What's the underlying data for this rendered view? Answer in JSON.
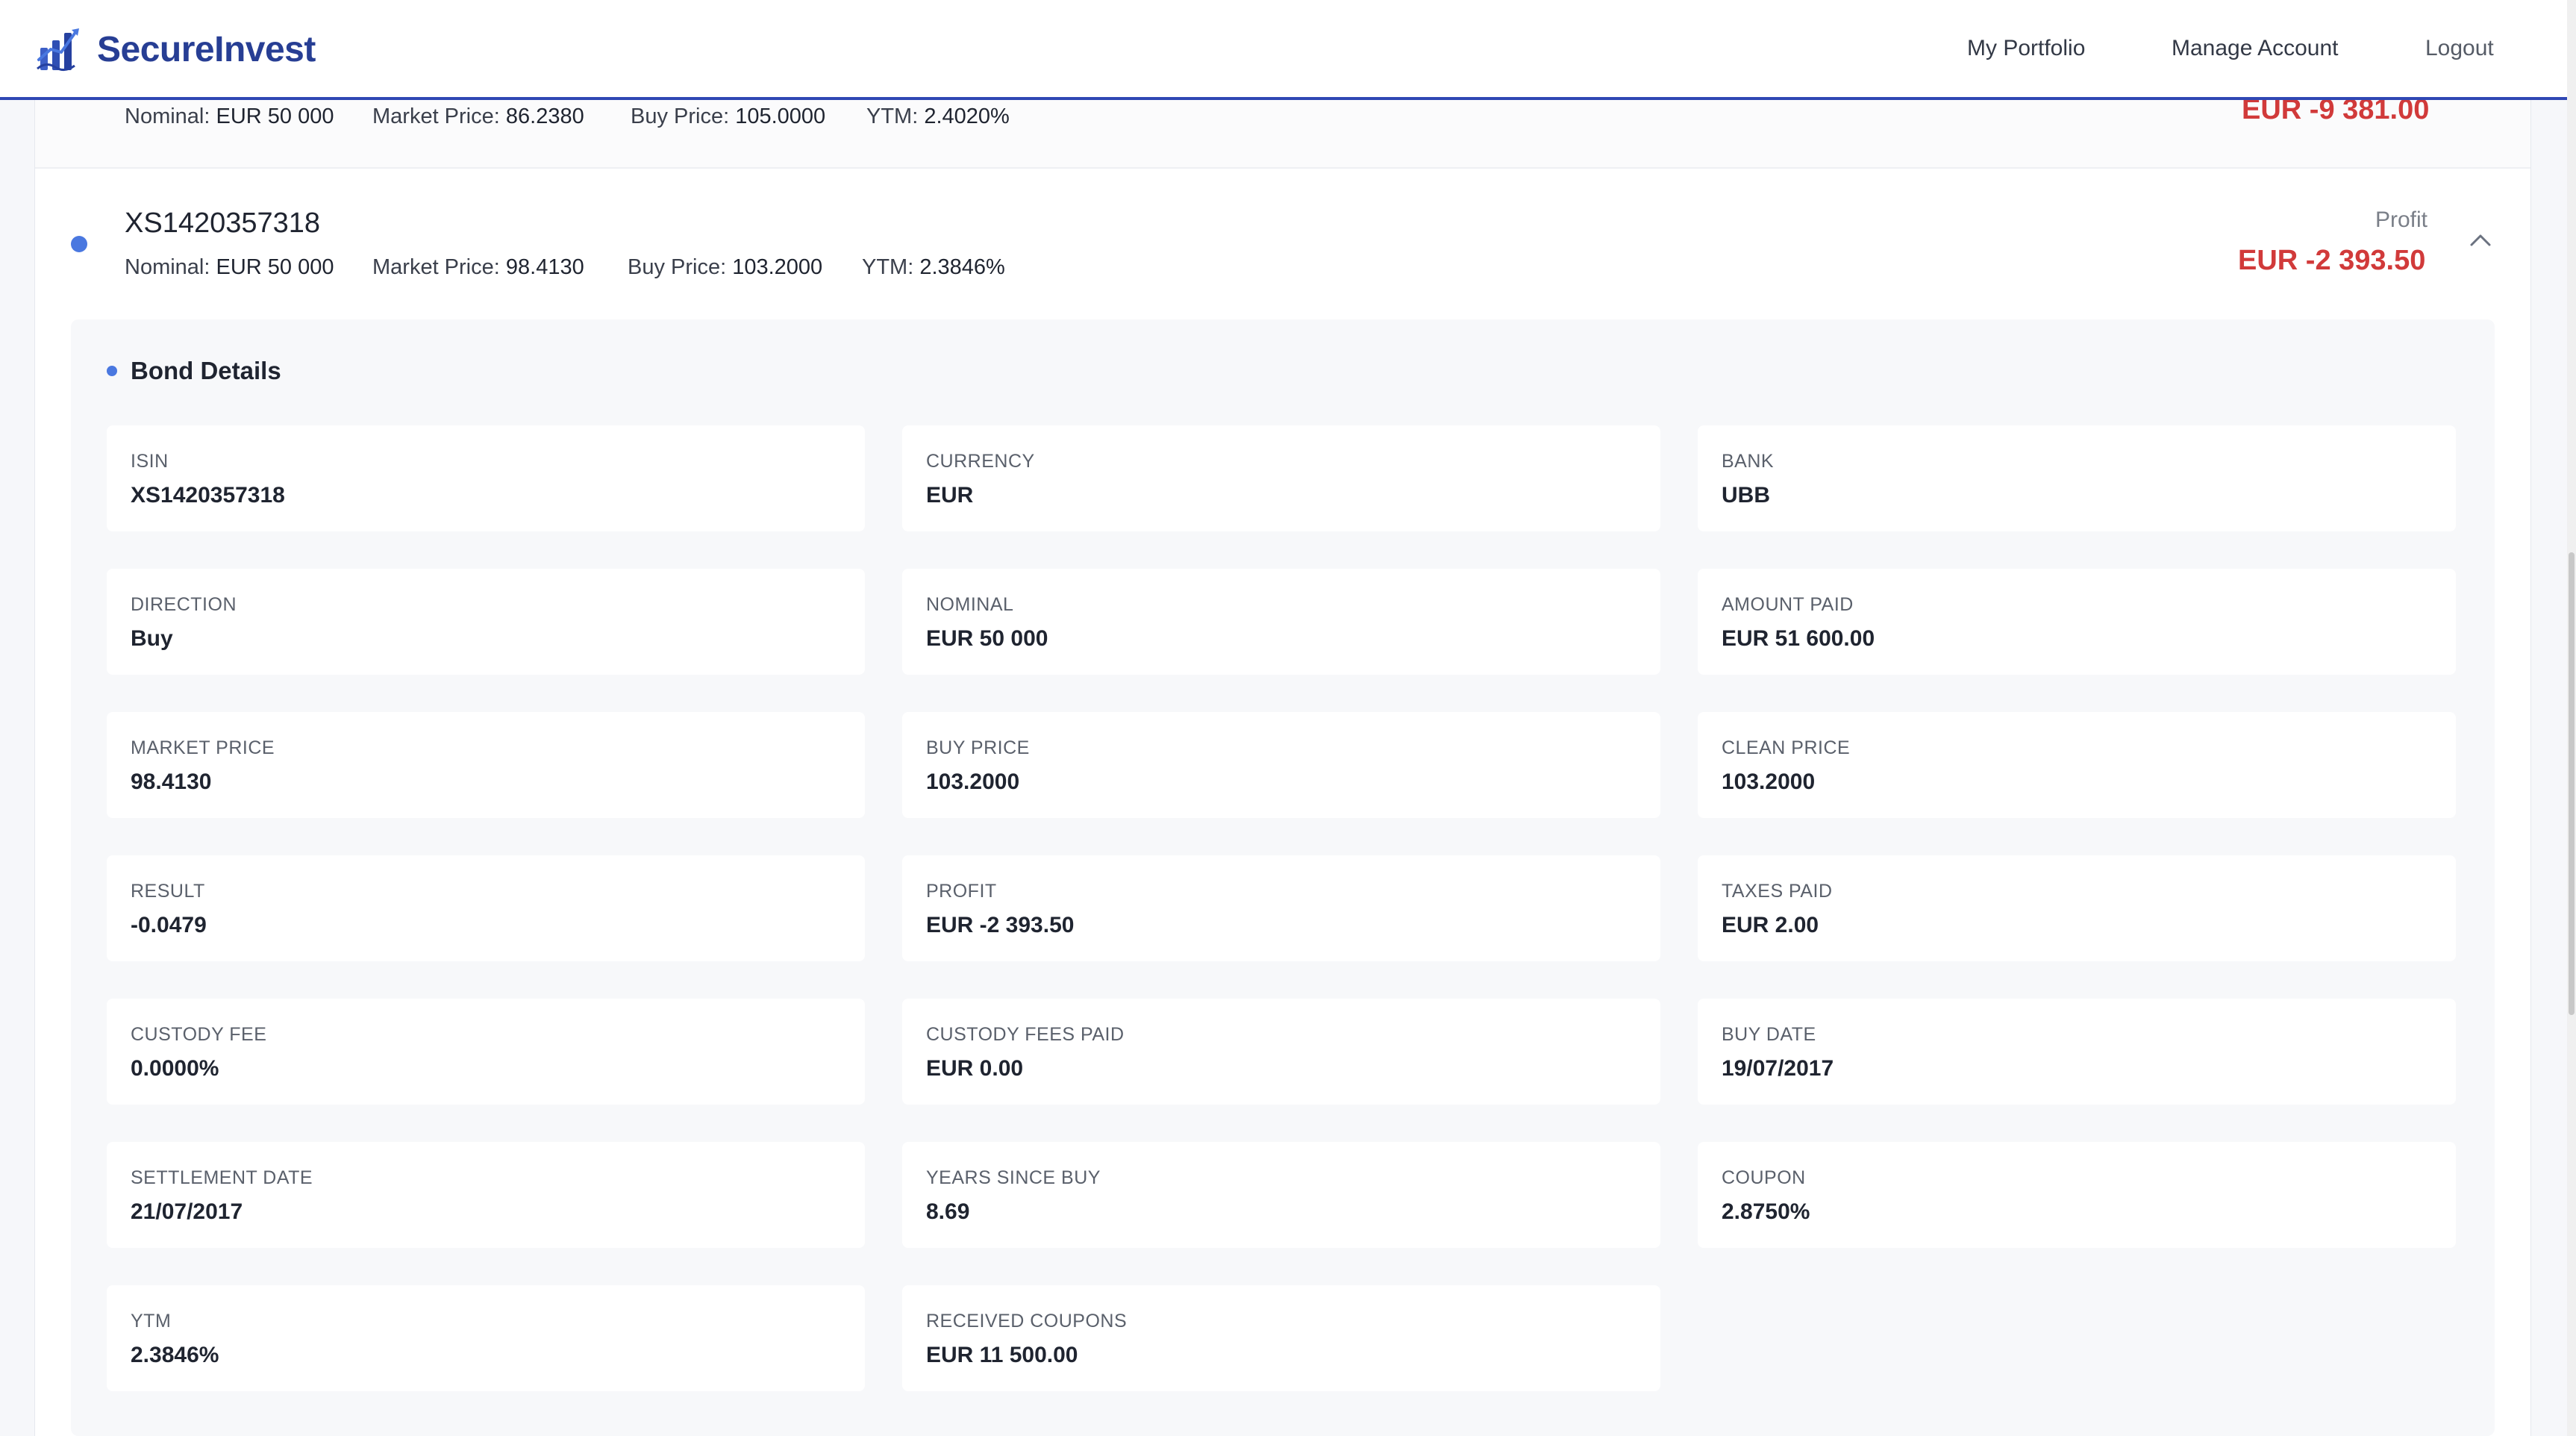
{
  "header": {
    "brand": "SecureInvest",
    "nav": {
      "portfolio": "My Portfolio",
      "manage": "Manage Account",
      "logout": "Logout"
    }
  },
  "previous_bond": {
    "nominal_label": "Nominal:",
    "nominal": "EUR 50 000",
    "market_label": "Market Price:",
    "market": "86.2380",
    "buy_label": "Buy Price:",
    "buy": "105.0000",
    "ytm_label": "YTM:",
    "ytm": "2.4020%",
    "profit": "EUR -9 381.00"
  },
  "bond": {
    "isin": "XS1420357318",
    "nominal_label": "Nominal:",
    "nominal": "EUR 50 000",
    "market_label": "Market Price:",
    "market": "98.4130",
    "buy_label": "Buy Price:",
    "buy": "103.2000",
    "ytm_label": "YTM:",
    "ytm": "2.3846%",
    "profit_label": "Profit",
    "profit": "EUR -2 393.50"
  },
  "details": {
    "title": "Bond Details",
    "fields": [
      {
        "label": "ISIN",
        "value": "XS1420357318"
      },
      {
        "label": "CURRENCY",
        "value": "EUR"
      },
      {
        "label": "BANK",
        "value": "UBB"
      },
      {
        "label": "DIRECTION",
        "value": "Buy"
      },
      {
        "label": "NOMINAL",
        "value": "EUR 50 000"
      },
      {
        "label": "AMOUNT PAID",
        "value": "EUR 51 600.00"
      },
      {
        "label": "MARKET PRICE",
        "value": "98.4130"
      },
      {
        "label": "BUY PRICE",
        "value": "103.2000"
      },
      {
        "label": "CLEAN PRICE",
        "value": "103.2000"
      },
      {
        "label": "RESULT",
        "value": "-0.0479"
      },
      {
        "label": "PROFIT",
        "value": "EUR -2 393.50"
      },
      {
        "label": "TAXES PAID",
        "value": "EUR 2.00"
      },
      {
        "label": "CUSTODY FEE",
        "value": "0.0000%"
      },
      {
        "label": "CUSTODY FEES PAID",
        "value": "EUR 0.00"
      },
      {
        "label": "BUY DATE",
        "value": "19/07/2017"
      },
      {
        "label": "SETTLEMENT DATE",
        "value": "21/07/2017"
      },
      {
        "label": "YEARS SINCE BUY",
        "value": "8.69"
      },
      {
        "label": "COUPON",
        "value": "2.8750%"
      },
      {
        "label": "YTM",
        "value": "2.3846%"
      },
      {
        "label": "RECEIVED COUPONS",
        "value": "EUR 11 500.00"
      }
    ]
  },
  "colors": {
    "brand": "#273e94",
    "accent": "#4a78e0",
    "loss": "#d13a3a"
  },
  "icons": {
    "logo": "chart-logo-icon",
    "chevron": "chevron-up-icon"
  }
}
